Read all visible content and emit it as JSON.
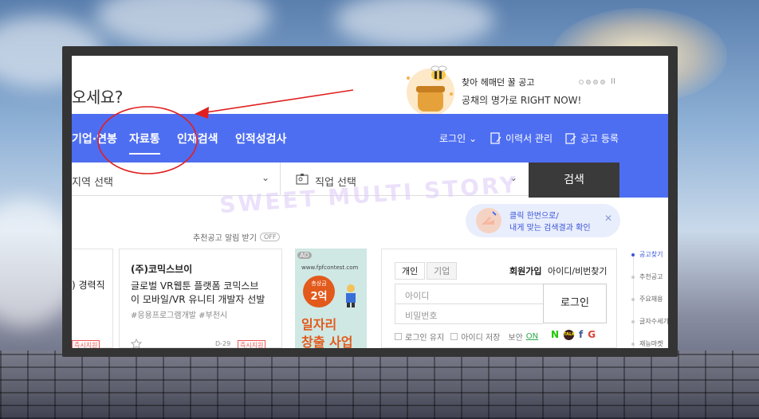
{
  "header": {
    "greeting": "오세요?",
    "promo_title": "찾아 헤매던 꿀 공고",
    "promo_subtitle": "공채의 명가로 RIGHT NOW!",
    "pause_label": "II"
  },
  "nav": {
    "items": [
      "기업·연봉",
      "자료통",
      "인재검색",
      "인적성검사"
    ],
    "login_label": "로그인",
    "resume_label": "이력서 관리",
    "post_label": "공고 등록"
  },
  "search": {
    "region_placeholder": "지역 선택",
    "job_placeholder": "직업 선택",
    "button_label": "검색"
  },
  "tooltip": {
    "line1": "클릭 한번으로/",
    "line2": "내게 맞는 검색결과 확인",
    "close": "✕"
  },
  "alarm": {
    "label": "추천공고 알림 받기",
    "state": "OFF"
  },
  "jobs": [
    {
      "company": "",
      "title": ") 경력직",
      "badge": "즉시지원"
    },
    {
      "company": "(주)코믹스브이",
      "title_line1": "글로벌 VR웹툰 플랫폼 코믹스브",
      "title_line2": "이 모바일/VR 유니티 개발자 선발",
      "tags": "#응용프로그램개발 #부천시",
      "deadline": "D-29",
      "badge": "즉시지원"
    }
  ],
  "ad": {
    "label": "AD",
    "url": "www.fpfcontest.com",
    "prize_small": "총상금",
    "prize_big": "2억",
    "headline1": "일자리",
    "headline2": "창출 사업"
  },
  "login": {
    "tab_personal": "개인",
    "tab_company": "기업",
    "join_label": "회원가입",
    "find_label": "아이디/비번찾기",
    "id_placeholder": "아이디",
    "pw_placeholder": "비밀번호",
    "button_label": "로그인",
    "keep_login": "로그인 유지",
    "save_id": "아이디 저장",
    "security_label": "보안",
    "security_state": "ON",
    "social": [
      "N",
      "TALK",
      "f",
      "G"
    ]
  },
  "sidenav": {
    "items": [
      "공고찾기",
      "추천공고",
      "주요채용",
      "글자수세기",
      "재능마켓"
    ]
  },
  "watermark": "SWEET MULTI STORY",
  "colors": {
    "brand_blue": "#4e6ef2",
    "annotation_red": "#e02020",
    "search_dark": "#3a3a3a"
  }
}
